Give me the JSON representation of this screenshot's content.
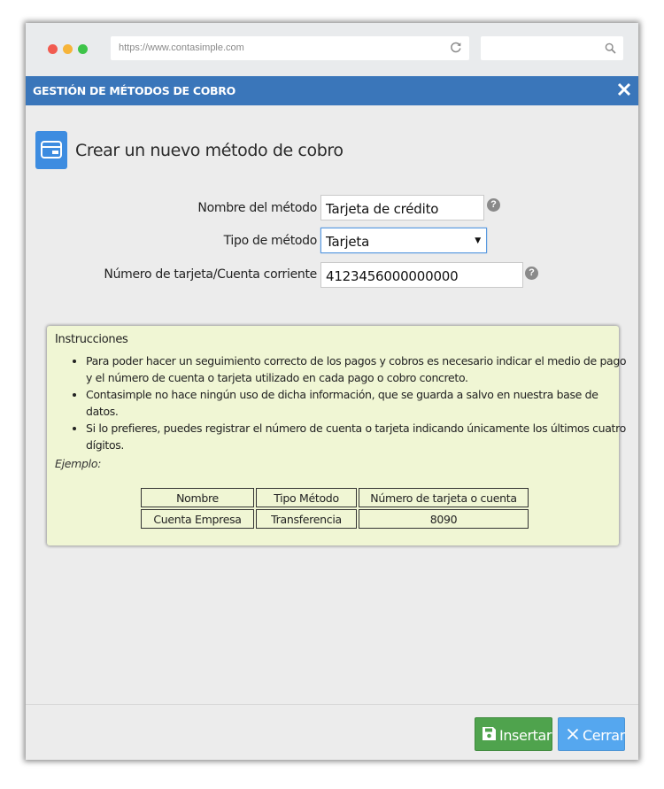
{
  "browser": {
    "url": "https://www.contasimple.com"
  },
  "dialog": {
    "title": "GESTIÓN DE MÉTODOS DE COBRO",
    "heading": "Crear un nuevo método de cobro"
  },
  "form": {
    "name_label": "Nombre del método",
    "name_value": "Tarjeta de crédito",
    "type_label": "Tipo de método",
    "type_value": "Tarjeta",
    "number_label": "Número de tarjeta/Cuenta corriente",
    "number_value": "4123456000000000"
  },
  "instructions": {
    "title": "Instrucciones",
    "items": [
      "Para poder hacer un seguimiento correcto de los pagos y cobros es necesario indicar el medio de pago y el número de cuenta o tarjeta utilizado en cada pago o cobro concreto.",
      "Contasimple no hace ningún uso de dicha información, que se guarda a salvo en nuestra base de datos.",
      "Si lo prefieres, puedes registrar el número de cuenta o tarjeta indicando únicamente los últimos cuatro dígitos."
    ],
    "example_label": "Ejemplo:",
    "table": {
      "headers": [
        "Nombre",
        "Tipo Método",
        "Número de tarjeta o cuenta"
      ],
      "row": [
        "Cuenta Empresa",
        "Transferencia",
        "8090"
      ]
    }
  },
  "buttons": {
    "insert": "Insertar",
    "close": "Cerrar"
  },
  "colors": {
    "titlebar": "#3a76ba",
    "insert_button": "#4fa34d",
    "close_button": "#55a7ef",
    "instructions_bg": "#f0f6d4"
  }
}
